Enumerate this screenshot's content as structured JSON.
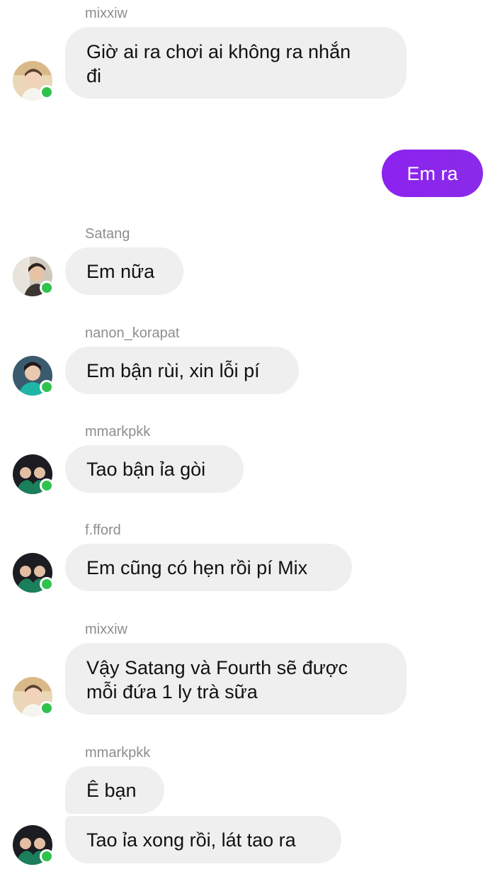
{
  "theme": {
    "own_bubble_color": "#8a2be2",
    "other_bubble_color": "#efefef",
    "online_dot_color": "#31c24d",
    "sender_name_color": "#8e8e8e"
  },
  "messages": [
    {
      "sender": "mixxiw",
      "text_line1": "Giờ ai ra chơi ai không ra nhắn",
      "text_line2": "đi"
    },
    {
      "sender": "me",
      "text": "Em ra"
    },
    {
      "sender": "Satang",
      "text": "Em nữa"
    },
    {
      "sender": "nanon_korapat",
      "text": "Em bận rùi, xin lỗi pí"
    },
    {
      "sender": "mmarkpkk",
      "text": "Tao bận ỉa gòi"
    },
    {
      "sender": "f.fford",
      "text": "Em cũng có hẹn rồi pí Mix"
    },
    {
      "sender": "mixxiw",
      "text_line1": "Vậy Satang và Fourth sẽ được",
      "text_line2": "mỗi đứa 1 ly trà sữa"
    },
    {
      "sender": "mmarkpkk",
      "text": "Ê bạn"
    },
    {
      "sender": "mmarkpkk",
      "text": "Tao ỉa xong rồi, lát tao ra"
    }
  ]
}
